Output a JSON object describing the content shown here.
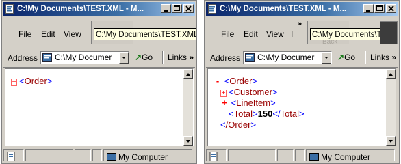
{
  "left": {
    "title": "C:\\My Documents\\TEST.XML - M...",
    "menu": {
      "file": "File",
      "edit": "Edit",
      "view": "View"
    },
    "tooltip": "C:\\My Documents\\TEST.XML -",
    "address": {
      "label": "Address",
      "value": "C:\\My Documer",
      "go": "Go",
      "links": "Links"
    },
    "xml": {
      "toggle": "+",
      "open": "<",
      "tag": "Order",
      "close": ">"
    },
    "status": {
      "zone": "My Computer"
    }
  },
  "right": {
    "title": "C:\\My Documents\\TEST.XML - M...",
    "menu": {
      "file": "File",
      "edit": "Edit",
      "view": "View"
    },
    "toolbar": {
      "back_label": "Back"
    },
    "tooltip": "C:\\My Documents\\TEST.X",
    "address": {
      "label": "Address",
      "value": "C:\\My Documer",
      "go": "Go",
      "links": "Links"
    },
    "xml": {
      "order_toggle": "-",
      "order_tag": "Order",
      "customer_toggle": "+",
      "customer_tag": "Customer",
      "lineitem_toggle": "+",
      "lineitem_tag": "LineItem",
      "total_tag": "Total",
      "total_value": "150",
      "order_close_tag": "/Order"
    },
    "status": {
      "zone": "My Computer"
    }
  }
}
